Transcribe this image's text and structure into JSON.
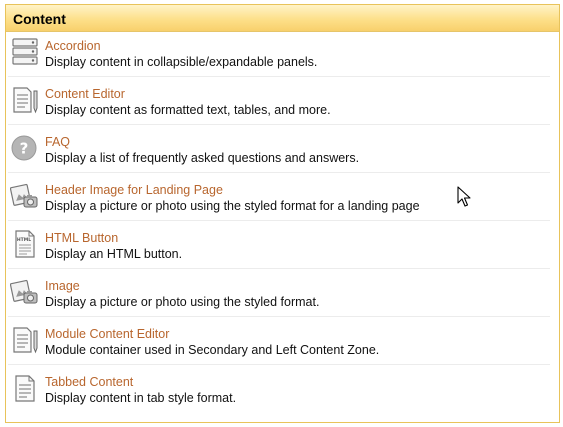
{
  "panel": {
    "title": "Content",
    "items": [
      {
        "icon": "accordion-icon",
        "title": "Accordion",
        "description": "Display content in collapsible/expandable panels."
      },
      {
        "icon": "content-editor-icon",
        "title": "Content Editor",
        "description": "Display content as formatted text, tables, and more."
      },
      {
        "icon": "question-icon",
        "title": "FAQ",
        "description": "Display a list of frequently asked questions and answers."
      },
      {
        "icon": "image-icon",
        "title": "Header Image for Landing Page",
        "description": "Display a picture or photo using the styled format for a landing page"
      },
      {
        "icon": "html-file-icon",
        "title": "HTML Button",
        "description": "Display an HTML button."
      },
      {
        "icon": "image-icon",
        "title": "Image",
        "description": "Display a picture or photo using the styled format."
      },
      {
        "icon": "content-editor-icon",
        "title": "Module Content Editor",
        "description": "Module container used in Secondary and Left Content Zone."
      },
      {
        "icon": "tabbed-content-icon",
        "title": "Tabbed Content",
        "description": "Display content in tab style format."
      }
    ]
  },
  "colors": {
    "title_link": "#b8662e",
    "header_gradient_top": "#fff3c8",
    "header_gradient_bottom": "#f8d06c",
    "border": "#e8c35a"
  }
}
